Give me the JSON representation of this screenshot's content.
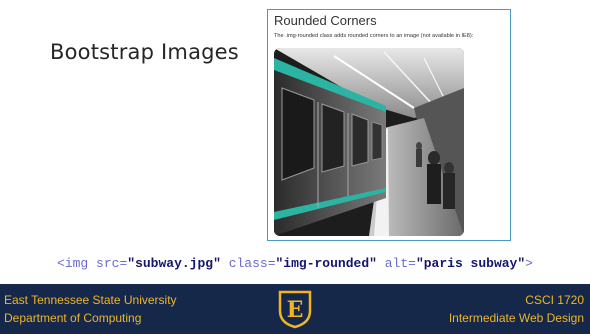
{
  "slide": {
    "title": "Bootstrap Images",
    "code": {
      "open": "<img ",
      "attr1": "src=",
      "val1": "\"subway.jpg\"",
      "attr2": " class=",
      "val2": "\"img-rounded\"",
      "attr3": " alt=",
      "val3": "\"paris subway\"",
      "close": ">"
    }
  },
  "demo": {
    "heading": "Rounded Corners",
    "description": "The .img-rounded class adds rounded corners to an image (not available in IE8):",
    "image_alt": "paris subway"
  },
  "footer": {
    "org_line1": "East Tennessee State University",
    "org_line2": "Department of Computing",
    "course_line1": "CSCI 1720",
    "course_line2": "Intermediate Web Design",
    "logo_letter": "E",
    "colors": {
      "background": "#15284a",
      "accent": "#f0b429"
    }
  }
}
